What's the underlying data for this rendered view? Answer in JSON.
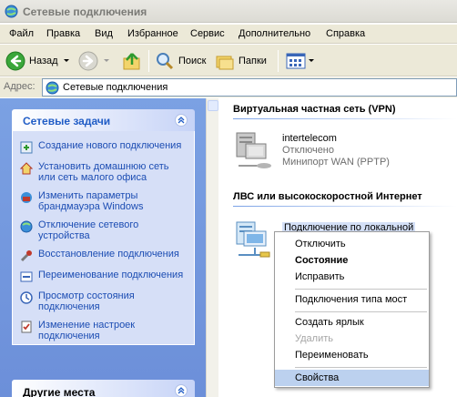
{
  "window": {
    "title": "Сетевые подключения"
  },
  "menu": [
    "Файл",
    "Правка",
    "Вид",
    "Избранное",
    "Сервис",
    "Дополнительно",
    "Справка"
  ],
  "toolbar": {
    "back": "Назад",
    "search": "Поиск",
    "folders": "Папки"
  },
  "address": {
    "label": "Адрес:",
    "value": "Сетевые подключения"
  },
  "left": {
    "tasks_title": "Сетевые задачи",
    "tasks": [
      "Создание нового подключения",
      "Установить домашнюю сеть или сеть малого офиса",
      "Изменить параметры брандмауэра Windows",
      "Отключение сетевого устройства",
      "Восстановление подключения",
      "Переименование подключения",
      "Просмотр состояния подключения",
      "Изменение настроек подключения"
    ],
    "other_title": "Другие места"
  },
  "right": {
    "vpn_group": "Виртуальная частная сеть (VPN)",
    "vpn_conn": {
      "name": "intertelecom",
      "status": "Отключено",
      "device": "Минипорт WAN (PPTP)"
    },
    "lan_group": "ЛВС или высокоскоростной Интернет",
    "lan_conn": {
      "name": "Подключение по локальной"
    }
  },
  "context_menu": [
    {
      "label": "Отключить",
      "style": "normal"
    },
    {
      "label": "Состояние",
      "style": "bold"
    },
    {
      "label": "Исправить",
      "style": "normal"
    },
    {
      "label": "Подключения типа мост",
      "style": "normal"
    },
    {
      "label": "Создать ярлык",
      "style": "normal"
    },
    {
      "label": "Удалить",
      "style": "disabled"
    },
    {
      "label": "Переименовать",
      "style": "normal"
    },
    {
      "label": "Свойства",
      "style": "hover"
    }
  ]
}
